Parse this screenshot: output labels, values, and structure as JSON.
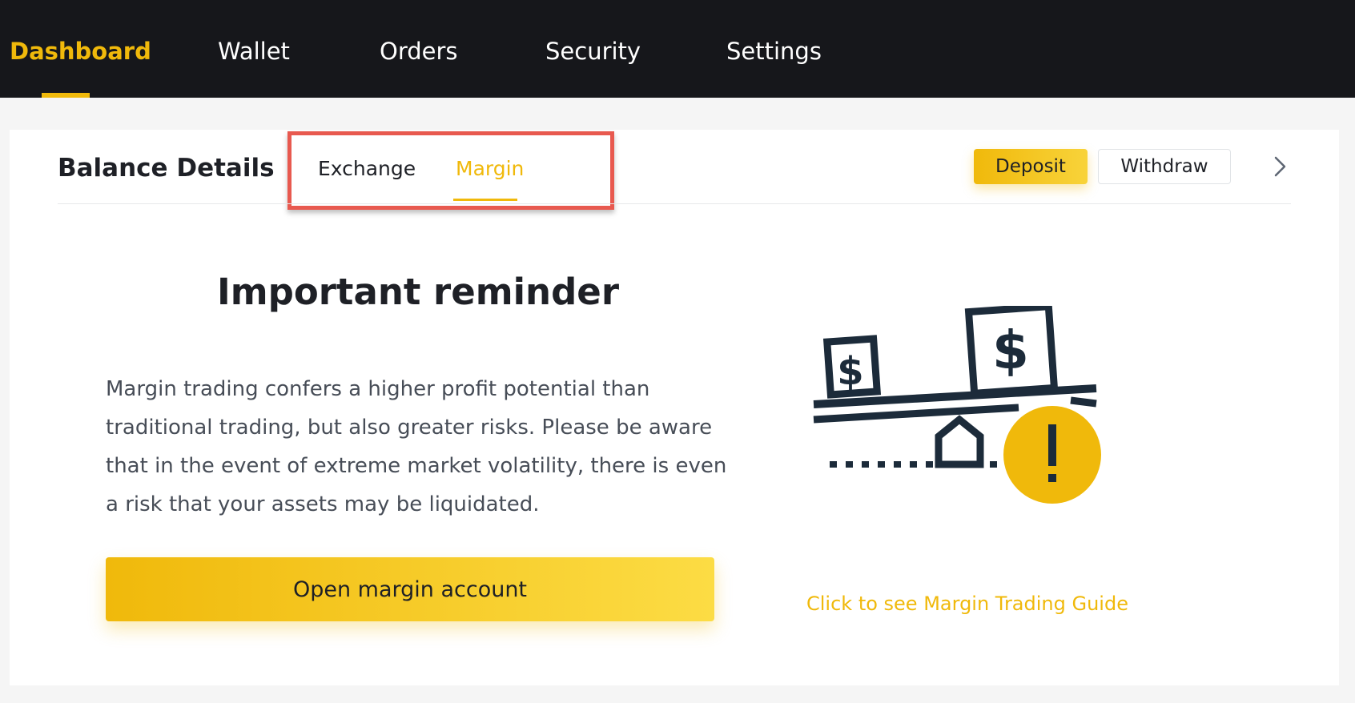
{
  "nav": {
    "items": [
      {
        "label": "Dashboard",
        "active": true
      },
      {
        "label": "Wallet",
        "active": false
      },
      {
        "label": "Orders",
        "active": false
      },
      {
        "label": "Security",
        "active": false
      },
      {
        "label": "Settings",
        "active": false
      }
    ]
  },
  "balance": {
    "title": "Balance Details",
    "tabs": [
      {
        "label": "Exchange",
        "active": false
      },
      {
        "label": "Margin",
        "active": true
      }
    ],
    "deposit_label": "Deposit",
    "withdraw_label": "Withdraw"
  },
  "reminder": {
    "title": "Important reminder",
    "text": "Margin trading confers a higher profit potential than traditional trading, but also greater risks. Please be aware that in the event of extreme market volatility, there is even a risk that your assets may be liquidated.",
    "button_label": "Open margin account",
    "guide_link": "Click to see Margin Trading Guide"
  },
  "colors": {
    "accent": "#f0b90b",
    "nav_bg": "#16171b",
    "highlight_border": "#e8594f",
    "text_dark": "#1e2026",
    "text_muted": "#474d57"
  },
  "icons": {
    "chevron": "chevron-right-icon",
    "illustration": "balance-scale-warning-icon",
    "dollar": "dollar-icon",
    "warning": "exclamation-icon"
  }
}
